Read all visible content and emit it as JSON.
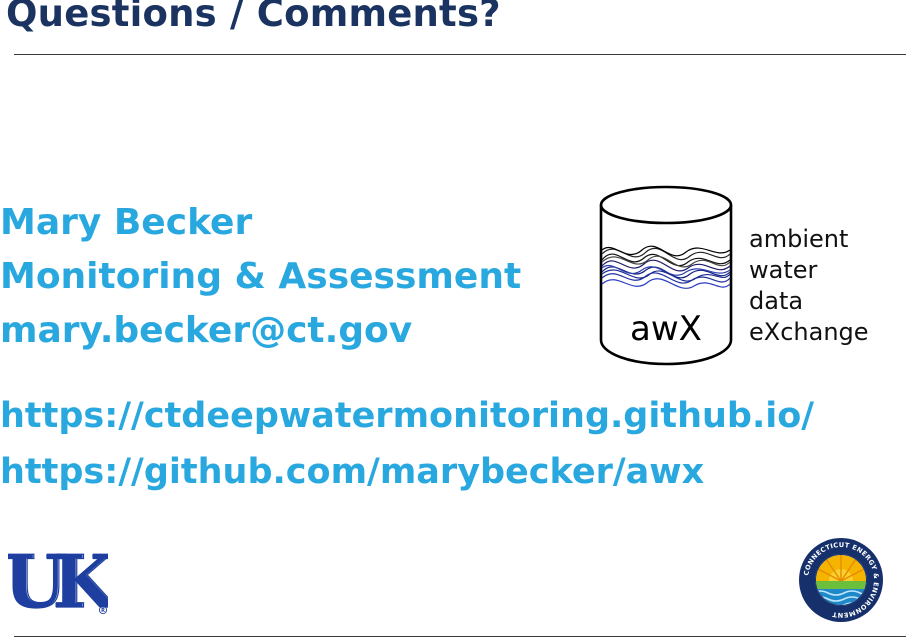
{
  "slide": {
    "title": "Questions / Comments?"
  },
  "contact": {
    "name": "Mary Becker",
    "department": "Monitoring & Assessment",
    "email": "mary.becker@ct.gov"
  },
  "links": [
    "https://ctdeepwatermonitoring.github.io/",
    "https://github.com/marybecker/awx"
  ],
  "awx": {
    "logo_text": "awX",
    "words": [
      "ambient",
      "water",
      "data",
      "eXchange"
    ]
  },
  "logos": {
    "uk_wordmark": "UK",
    "ct_seal_text": "CONNECTICUT ENERGY & ENVIRONMENT"
  },
  "colors": {
    "title": "#1b3361",
    "accent": "#29a8e0",
    "uk_blue": "#1e3fa0",
    "ct_navy": "#15306a"
  }
}
